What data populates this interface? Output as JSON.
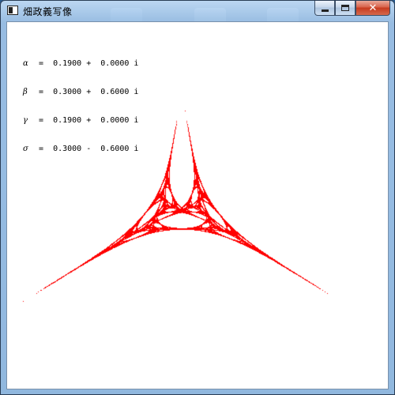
{
  "window": {
    "title": "畑政義写像",
    "icon": "app-window-icon",
    "buttons": {
      "minimize": "minimize",
      "maximize": "maximize",
      "close": "✕"
    }
  },
  "parameters": [
    {
      "symbol": "α",
      "expr": " =  0.1900 +  0.0000 i"
    },
    {
      "symbol": "β",
      "expr": " =  0.3000 +  0.6000 i"
    },
    {
      "symbol": "γ",
      "expr": " =  0.1900 +  0.0000 i"
    },
    {
      "symbol": "σ",
      "expr": " =  0.3000 -  0.6000 i"
    }
  ],
  "colors": {
    "fractal": "#ff0000",
    "background": "#ffffff"
  }
}
